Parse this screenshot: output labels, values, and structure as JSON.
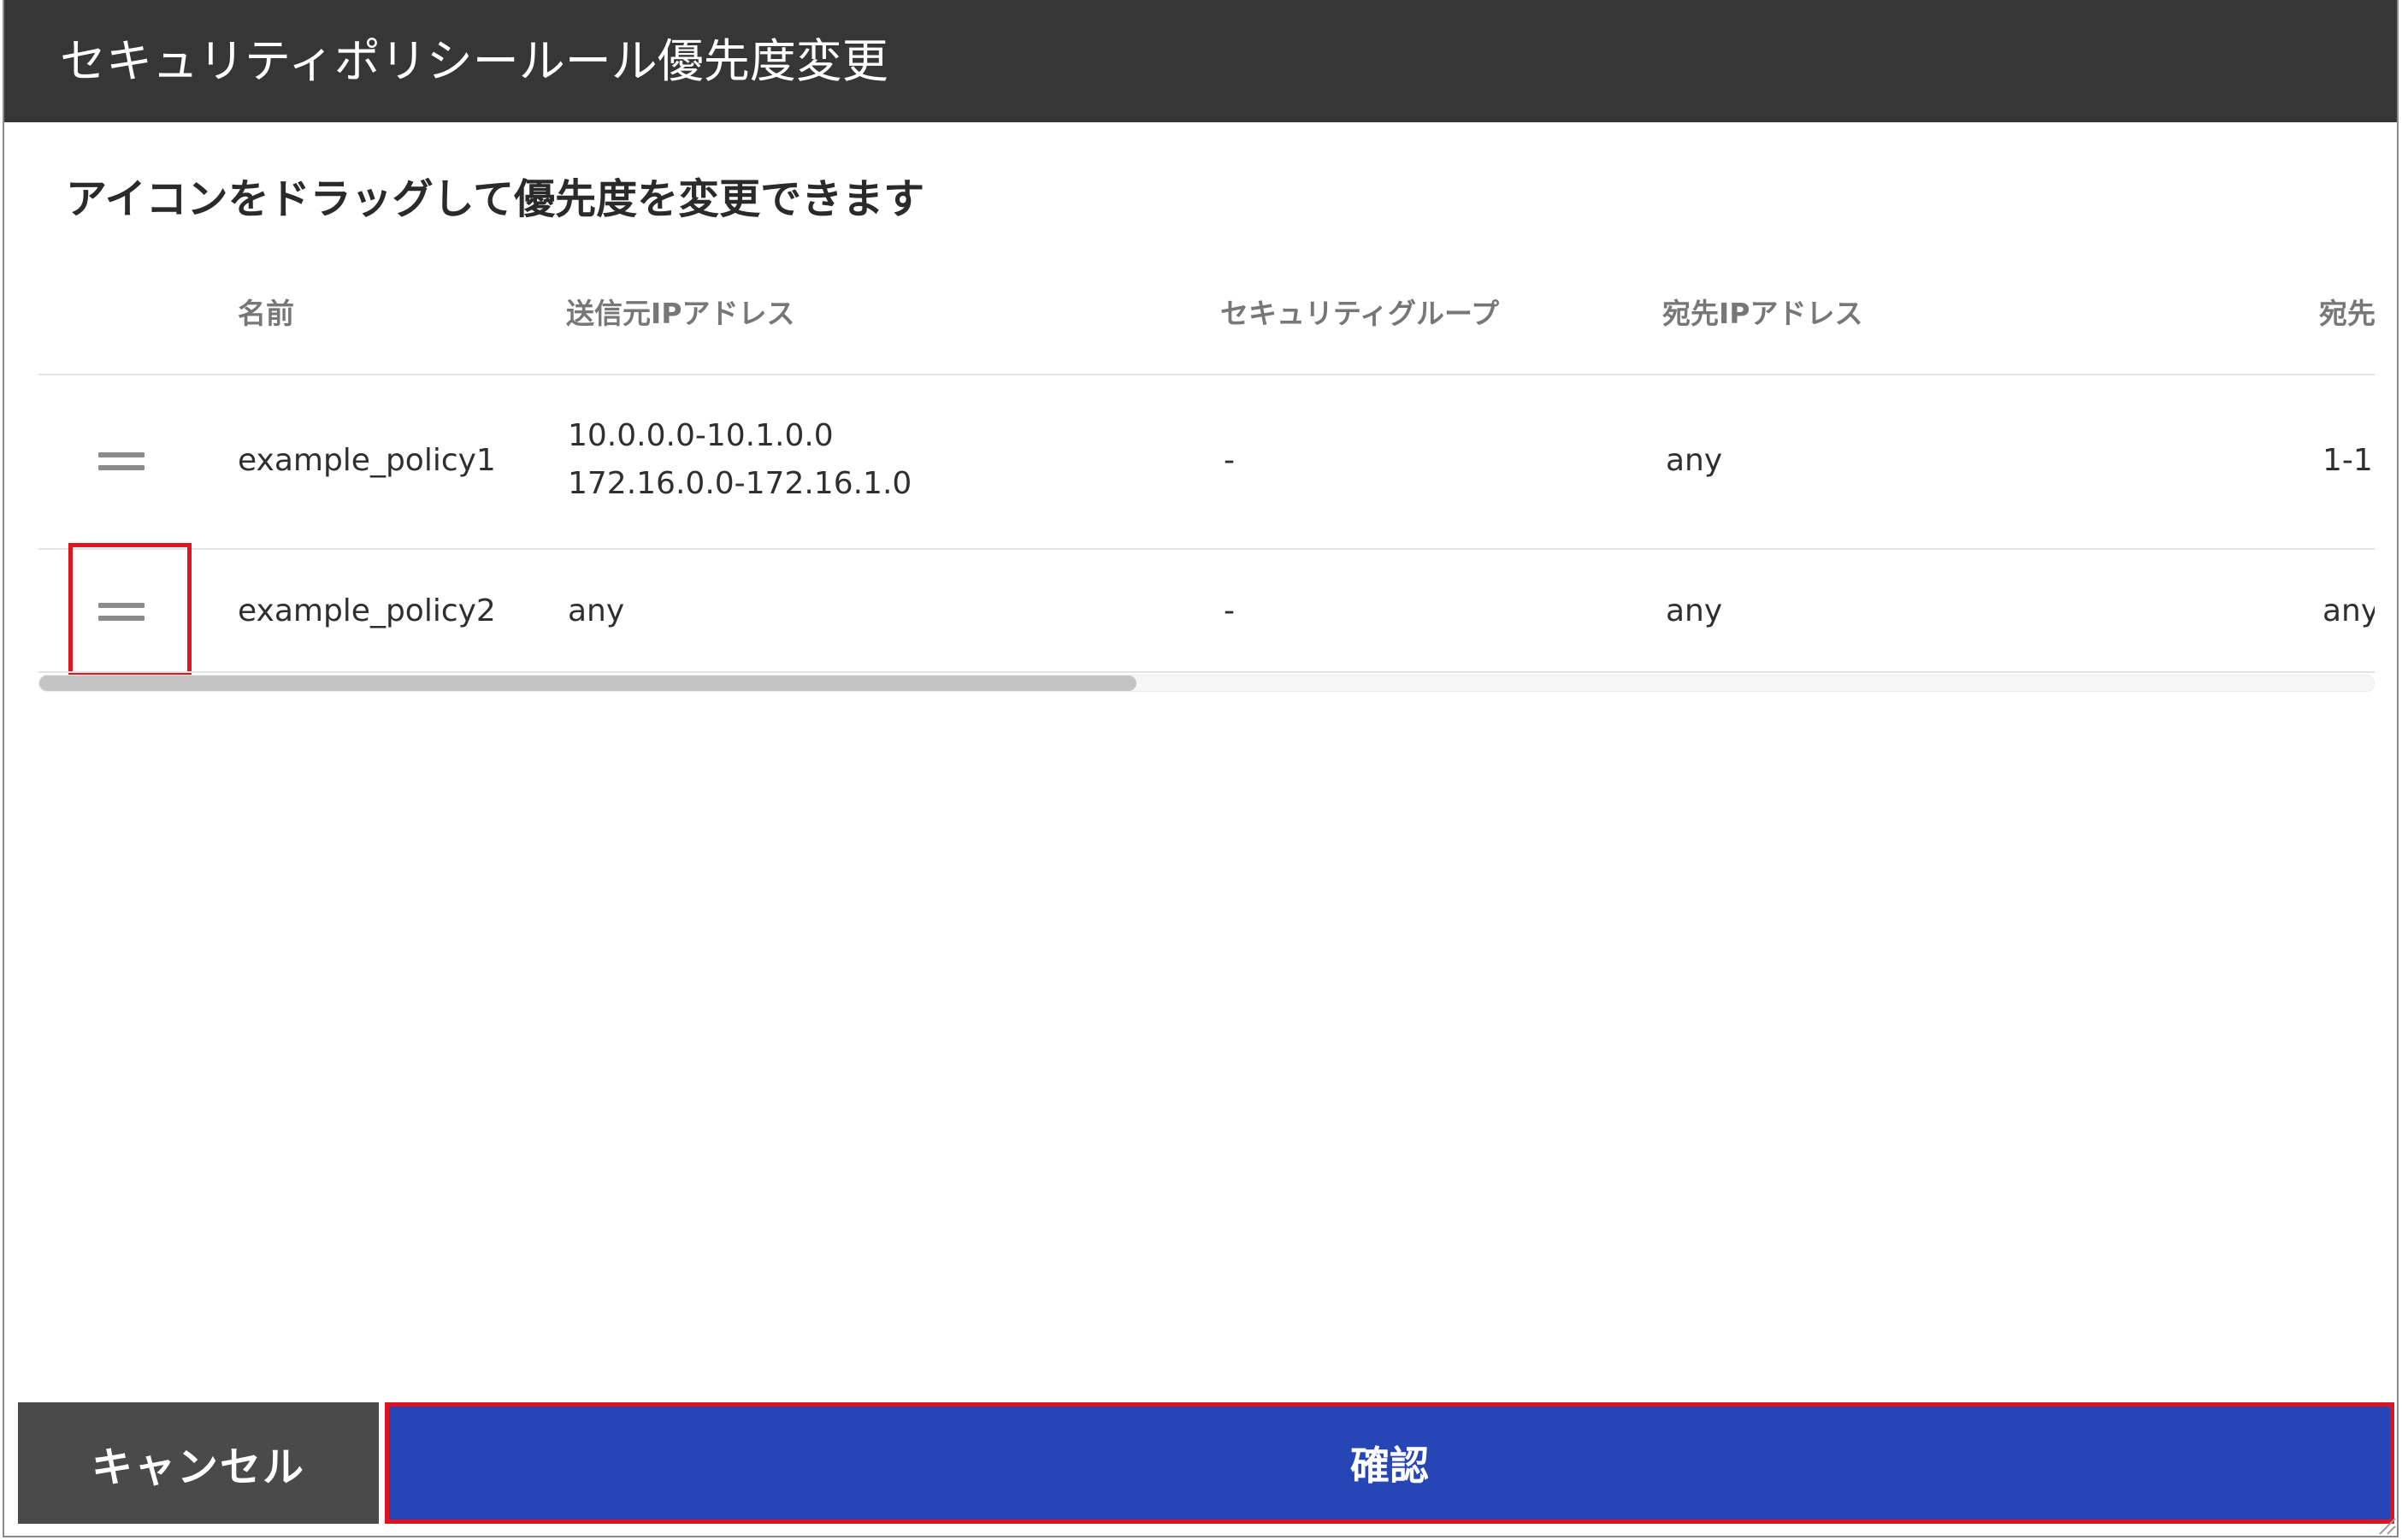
{
  "dialog": {
    "title": "セキュリティポリシールール優先度変更",
    "instruction": "アイコンをドラッグして優先度を変更できます"
  },
  "table": {
    "columns": {
      "name": "名前",
      "source_ip": "送信元IPアドレス",
      "security_group": "セキュリティグループ",
      "destination_ip": "宛先IPアドレス",
      "destination_port": "宛先"
    },
    "rows": [
      {
        "name": "example_policy1",
        "source_ip": [
          "10.0.0.0-10.1.0.0",
          "172.16.0.0-172.16.1.0"
        ],
        "security_group": "-",
        "destination_ip": "any",
        "destination_port": "1-1"
      },
      {
        "name": "example_policy2",
        "source_ip": [
          "any"
        ],
        "security_group": "-",
        "destination_ip": "any",
        "destination_port": "any"
      }
    ],
    "scroll_fraction_visible": 0.47
  },
  "buttons": {
    "cancel_label": "キャンセル",
    "confirm_label": "確認"
  },
  "icons": {
    "drag_handle": "drag-handle-icon",
    "resize_grip": "resize-grip-icon"
  },
  "colors": {
    "header_bg": "#363636",
    "confirm_bg": "#2746b6",
    "cancel_bg": "#4a4a4a",
    "highlight": "#e0141f"
  }
}
